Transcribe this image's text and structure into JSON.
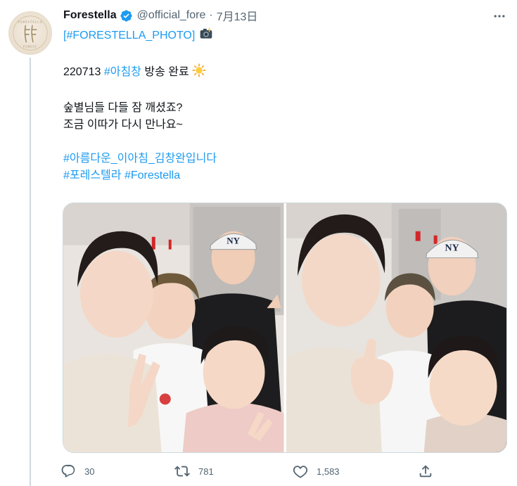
{
  "author": {
    "display_name": "Forestella",
    "handle": "@official_fore",
    "separator": "·",
    "date": "7月13日",
    "avatar_text": "FORESTELLA"
  },
  "tweet": {
    "line1_tag": "[#FORESTELLA_PHOTO]",
    "line2_prefix": "220713 ",
    "line2_hashtag": "#아침창",
    "line2_suffix": " 방송 완료 ",
    "line3": "숲별님들 다들 잠 깨셨죠?",
    "line4": "조금 이따가 다시 만나요~",
    "hashtag_line1": "#아름다운_이아침_김창완입니다",
    "hashtag_line2_a": "#포레스텔라",
    "hashtag_line2_b": "#Forestella"
  },
  "icons": {
    "verified": "verified-badge-icon",
    "camera": "camera-flash-emoji",
    "sun": "sun-emoji",
    "more": "more-options-icon"
  },
  "colors": {
    "link": "#1d9bf0",
    "muted": "#536471",
    "text": "#0f1419"
  },
  "actions": {
    "reply_count": "30",
    "retweet_count": "781",
    "like_count": "1,583"
  }
}
